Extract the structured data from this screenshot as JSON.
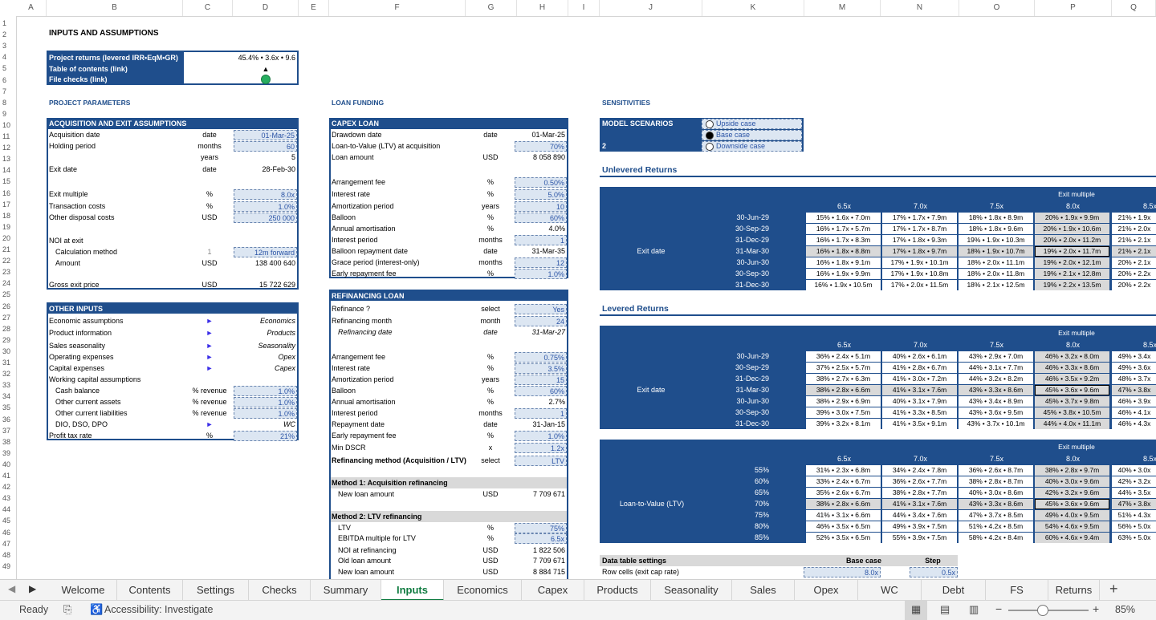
{
  "columns": [
    "A",
    "B",
    "C",
    "D",
    "E",
    "F",
    "G",
    "H",
    "I",
    "J",
    "K",
    "L",
    "M",
    "N",
    "O",
    "P",
    "Q"
  ],
  "rows": [
    "1",
    "2",
    "3",
    "4",
    "5",
    "6",
    "7",
    "8",
    "9",
    "10",
    "11",
    "12",
    "13",
    "14",
    "15",
    "16",
    "17",
    "18",
    "19",
    "20",
    "21",
    "22",
    "23",
    "24",
    "25",
    "26",
    "27",
    "28",
    "29",
    "30",
    "31",
    "32",
    "33",
    "34",
    "35",
    "36",
    "37",
    "38",
    "39",
    "40",
    "41",
    "42",
    "43",
    "44",
    "45",
    "46",
    "47",
    "48",
    "49"
  ],
  "title": "INPUTS AND ASSUMPTIONS",
  "summary": {
    "returns_label": "Project returns (levered IRR•EqM•GR)",
    "returns_value": "45.4% • 3.6x • 9.6",
    "toc_label": "Table of contents (link)",
    "toc_icon": "▲",
    "checks_label": "File checks (link)",
    "check_color": "#27ae60"
  },
  "sections": {
    "project": "PROJECT PARAMETERS",
    "loan": "LOAN FUNDING",
    "sens": "SENSITIVITIES"
  },
  "acq": {
    "header": "ACQUISITION AND EXIT ASSUMPTIONS",
    "rows": [
      {
        "label": "Acquisition date",
        "unit": "date",
        "value": "01-Mar-25",
        "input": true
      },
      {
        "label": "Holding period",
        "unit": "months",
        "value": "60",
        "input": true
      },
      {
        "label": "",
        "unit": "years",
        "value": "5",
        "input": false
      },
      {
        "label": "Exit date",
        "unit": "date",
        "value": "28-Feb-30",
        "input": false
      },
      {
        "label": "Exit multiple",
        "unit": "%",
        "value": "8.0x",
        "input": true
      },
      {
        "label": "Transaction costs",
        "unit": "%",
        "value": "1.0%",
        "input": true
      },
      {
        "label": "Other disposal costs",
        "unit": "USD",
        "value": "250 000",
        "input": true
      },
      {
        "label": "NOI at exit",
        "unit": "",
        "value": "",
        "input": false
      },
      {
        "label": "Calculation method",
        "unit": "1",
        "value": "12m forward",
        "input": true
      },
      {
        "label": "Amount",
        "unit": "USD",
        "value": "138 400 640",
        "input": false
      },
      {
        "label": "Gross exit price",
        "unit": "USD",
        "value": "15 722 629",
        "input": false
      }
    ]
  },
  "other": {
    "header": "OTHER INPUTS",
    "rows": [
      {
        "label": "Economic assumptions",
        "unit": "►",
        "value": "Economics"
      },
      {
        "label": "Product information",
        "unit": "►",
        "value": "Products"
      },
      {
        "label": "Sales seasonality",
        "unit": "►",
        "value": "Seasonality"
      },
      {
        "label": "Operating expenses",
        "unit": "►",
        "value": "Opex"
      },
      {
        "label": "Capital expenses",
        "unit": "►",
        "value": "Capex"
      },
      {
        "label": "Working capital assumptions",
        "unit": "",
        "value": ""
      },
      {
        "label": "Cash balance",
        "unit": "% revenue",
        "value": "1.0%"
      },
      {
        "label": "Other current assets",
        "unit": "% revenue",
        "value": "1.0%"
      },
      {
        "label": "Other current liabilities",
        "unit": "% revenue",
        "value": "1.0%"
      },
      {
        "label": "DIO, DSO, DPO",
        "unit": "►",
        "value": "WC"
      },
      {
        "label": "Profit tax rate",
        "unit": "%",
        "value": "21%"
      }
    ]
  },
  "capex": {
    "header": "CAPEX LOAN",
    "rows": [
      {
        "label": "Drawdown date",
        "unit": "date",
        "value": "01-Mar-25"
      },
      {
        "label": "Loan-to-Value (LTV) at acquisition",
        "unit": "",
        "value": "70%"
      },
      {
        "label": "Loan amount",
        "unit": "USD",
        "value": "8 058 890"
      },
      {
        "label": "Arrangement fee",
        "unit": "%",
        "value": "0.50%"
      },
      {
        "label": "Interest rate",
        "unit": "%",
        "value": "5.0%"
      },
      {
        "label": "Amortization period",
        "unit": "years",
        "value": "10"
      },
      {
        "label": "Balloon",
        "unit": "%",
        "value": "60%"
      },
      {
        "label": "Annual amortisation",
        "unit": "%",
        "value": "4.0%"
      },
      {
        "label": "Interest period",
        "unit": "months",
        "value": "1"
      },
      {
        "label": "Balloon repayment date",
        "unit": "date",
        "value": "31-Mar-35"
      },
      {
        "label": "Grace period (interest-only)",
        "unit": "months",
        "value": "12"
      },
      {
        "label": "Early repayment fee",
        "unit": "%",
        "value": "1.0%"
      }
    ]
  },
  "refi": {
    "header": "REFINANCING LOAN",
    "rows": [
      {
        "label": "Refinance ?",
        "unit": "select",
        "value": "Yes"
      },
      {
        "label": "Refinancing month",
        "unit": "month",
        "value": "24"
      },
      {
        "label": "Refinancing date",
        "unit": "date",
        "value": "31-Mar-27"
      },
      {
        "label": "Arrangement fee",
        "unit": "%",
        "value": "0.75%"
      },
      {
        "label": "Interest rate",
        "unit": "%",
        "value": "3.5%"
      },
      {
        "label": "Amortization period",
        "unit": "years",
        "value": "15"
      },
      {
        "label": "Balloon",
        "unit": "%",
        "value": "60%"
      },
      {
        "label": "Annual amortisation",
        "unit": "%",
        "value": "2.7%"
      },
      {
        "label": "Interest period",
        "unit": "months",
        "value": "1"
      },
      {
        "label": "Repayment date",
        "unit": "date",
        "value": "31-Jan-15"
      },
      {
        "label": "Early repayment fee",
        "unit": "%",
        "value": "1.0%"
      },
      {
        "label": "Min DSCR",
        "unit": "x",
        "value": "1.2x"
      },
      {
        "label": "Refinancing method (Acquisition / LTV)",
        "unit": "select",
        "value": "LTV"
      },
      {
        "label": "Method 1: Acquisition refinancing",
        "unit": "",
        "value": ""
      },
      {
        "label": "New loan amount",
        "unit": "USD",
        "value": "7 709 671"
      },
      {
        "label": "Method 2: LTV refinancing",
        "unit": "",
        "value": ""
      },
      {
        "label": "LTV",
        "unit": "%",
        "value": "75%"
      },
      {
        "label": "EBITDA multiple for LTV",
        "unit": "%",
        "value": "6.5x"
      },
      {
        "label": "NOI at refinancing",
        "unit": "USD",
        "value": "1 822 506"
      },
      {
        "label": "Old loan amount",
        "unit": "USD",
        "value": "7 709 671"
      },
      {
        "label": "New loan amount",
        "unit": "USD",
        "value": "8 884 715"
      }
    ]
  },
  "scenarios": {
    "header": "MODEL SCENARIOS",
    "selected": "2",
    "options": [
      "Upside case",
      "Base case",
      "Downside case"
    ]
  },
  "unlevered": {
    "title": "Unlevered Returns",
    "col_header": "Exit multiple",
    "row_header": "Exit date",
    "cols": [
      "6.5x",
      "7.0x",
      "7.5x",
      "8.0x",
      "8.5x"
    ],
    "rows": [
      "30-Jun-29",
      "30-Sep-29",
      "31-Dec-29",
      "31-Mar-30",
      "30-Jun-30",
      "30-Sep-30",
      "31-Dec-30"
    ],
    "cells": [
      [
        "15% • 1.6x • 7.0m",
        "17% • 1.7x • 7.9m",
        "18% • 1.8x • 8.9m",
        "20% • 1.9x • 9.9m",
        "21% • 1.9x"
      ],
      [
        "16% • 1.7x • 5.7m",
        "17% • 1.7x • 8.7m",
        "18% • 1.8x • 9.6m",
        "20% • 1.9x • 10.6m",
        "21% • 2.0x"
      ],
      [
        "16% • 1.7x • 8.3m",
        "17% • 1.8x • 9.3m",
        "19% • 1.9x • 10.3m",
        "20% • 2.0x • 11.2m",
        "21% • 2.1x"
      ],
      [
        "16% • 1.8x • 8.8m",
        "17% • 1.8x • 9.7m",
        "18% • 1.9x • 10.7m",
        "19% • 2.0x • 11.7m",
        "21% • 2.1x"
      ],
      [
        "16% • 1.8x • 9.1m",
        "17% • 1.9x • 10.1m",
        "18% • 2.0x • 11.1m",
        "19% • 2.0x • 12.1m",
        "20% • 2.1x"
      ],
      [
        "16% • 1.9x • 9.9m",
        "17% • 1.9x • 10.8m",
        "18% • 2.0x • 11.8m",
        "19% • 2.1x • 12.8m",
        "20% • 2.2x"
      ],
      [
        "16% • 1.9x • 10.5m",
        "17% • 2.0x • 11.5m",
        "18% • 2.1x • 12.5m",
        "19% • 2.2x • 13.5m",
        "20% • 2.2x"
      ]
    ]
  },
  "levered": {
    "title": "Levered Returns",
    "col_header": "Exit multiple",
    "row_header": "Exit date",
    "cols": [
      "6.5x",
      "7.0x",
      "7.5x",
      "8.0x",
      "8.5x"
    ],
    "rows": [
      "30-Jun-29",
      "30-Sep-29",
      "31-Dec-29",
      "31-Mar-30",
      "30-Jun-30",
      "30-Sep-30",
      "31-Dec-30"
    ],
    "cells": [
      [
        "36% • 2.4x • 5.1m",
        "40% • 2.6x • 6.1m",
        "43% • 2.9x • 7.0m",
        "46% • 3.2x • 8.0m",
        "49% • 3.4x"
      ],
      [
        "37% • 2.5x • 5.7m",
        "41% • 2.8x • 6.7m",
        "44% • 3.1x • 7.7m",
        "46% • 3.3x • 8.6m",
        "49% • 3.6x"
      ],
      [
        "38% • 2.7x • 6.3m",
        "41% • 3.0x • 7.2m",
        "44% • 3.2x • 8.2m",
        "46% • 3.5x • 9.2m",
        "48% • 3.7x"
      ],
      [
        "38% • 2.8x • 6.6m",
        "41% • 3.1x • 7.6m",
        "43% • 3.3x • 8.6m",
        "45% • 3.6x • 9.6m",
        "47% • 3.8x"
      ],
      [
        "38% • 2.9x • 6.9m",
        "40% • 3.1x • 7.9m",
        "43% • 3.4x • 8.9m",
        "45% • 3.7x • 9.8m",
        "46% • 3.9x"
      ],
      [
        "39% • 3.0x • 7.5m",
        "41% • 3.3x • 8.5m",
        "43% • 3.6x • 9.5m",
        "45% • 3.8x • 10.5m",
        "46% • 4.1x"
      ],
      [
        "39% • 3.2x • 8.1m",
        "41% • 3.5x • 9.1m",
        "43% • 3.7x • 10.1m",
        "44% • 4.0x • 11.1m",
        "46% • 4.3x"
      ]
    ]
  },
  "ltv_table": {
    "col_header": "Exit multiple",
    "row_header": "Loan-to-Value (LTV)",
    "cols": [
      "6.5x",
      "7.0x",
      "7.5x",
      "8.0x",
      "8.5x"
    ],
    "rows": [
      "55%",
      "60%",
      "65%",
      "70%",
      "75%",
      "80%",
      "85%"
    ],
    "cells": [
      [
        "31% • 2.3x • 6.8m",
        "34% • 2.4x • 7.8m",
        "36% • 2.6x • 8.7m",
        "38% • 2.8x • 9.7m",
        "40% • 3.0x"
      ],
      [
        "33% • 2.4x • 6.7m",
        "36% • 2.6x • 7.7m",
        "38% • 2.8x • 8.7m",
        "40% • 3.0x • 9.6m",
        "42% • 3.2x"
      ],
      [
        "35% • 2.6x • 6.7m",
        "38% • 2.8x • 7.7m",
        "40% • 3.0x • 8.6m",
        "42% • 3.2x • 9.6m",
        "44% • 3.5x"
      ],
      [
        "38% • 2.8x • 6.6m",
        "41% • 3.1x • 7.6m",
        "43% • 3.3x • 8.6m",
        "45% • 3.6x • 9.6m",
        "47% • 3.8x"
      ],
      [
        "41% • 3.1x • 6.6m",
        "44% • 3.4x • 7.6m",
        "47% • 3.7x • 8.5m",
        "49% • 4.0x • 9.5m",
        "51% • 4.3x"
      ],
      [
        "46% • 3.5x • 6.5m",
        "49% • 3.9x • 7.5m",
        "51% • 4.2x • 8.5m",
        "54% • 4.6x • 9.5m",
        "56% • 5.0x"
      ],
      [
        "52% • 3.5x • 6.5m",
        "55% • 3.9x • 7.5m",
        "58% • 4.2x • 8.4m",
        "60% • 4.6x • 9.4m",
        "63% • 5.0x"
      ]
    ]
  },
  "dts": {
    "label": "Data table settings",
    "base": "Base case",
    "step": "Step",
    "row_label": "Row cells (exit cap rate)",
    "row_base": "8.0x",
    "row_step": "0.5x"
  },
  "tabs": [
    "Welcome",
    "Contents",
    "Settings",
    "Checks",
    "Summary",
    "Inputs",
    "Economics",
    "Capex",
    "Products",
    "Seasonality",
    "Sales",
    "Opex",
    "WC",
    "Debt",
    "FS",
    "Returns"
  ],
  "status": {
    "ready": "Ready",
    "accessibility": "Accessibility: Investigate",
    "zoom": "85%"
  }
}
